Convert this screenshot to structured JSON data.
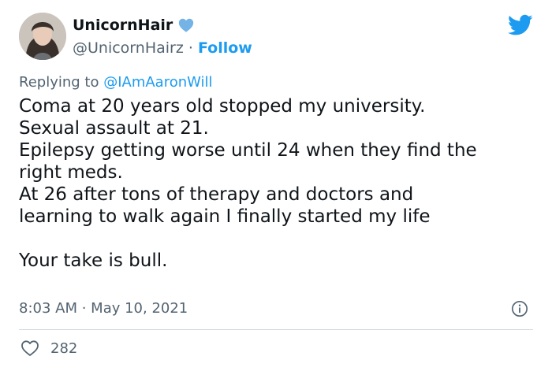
{
  "author": {
    "display_name": "UnicornHair",
    "handle": "@UnicornHairz",
    "separator": " · ",
    "follow_label": "Follow"
  },
  "reply": {
    "prefix": "Replying to ",
    "handle": "@IAmAaronWill"
  },
  "tweet": {
    "lines": [
      "Coma at 20 years old stopped my university.",
      "Sexual assault at 21.",
      "Epilepsy getting worse until 24 when they find the",
      "right meds.",
      "At 26 after tons of therapy and doctors and",
      "learning to walk again I finally started my life",
      "",
      "Your take is bull."
    ]
  },
  "meta": {
    "time": "8:03 AM",
    "separator": " · ",
    "date": "May 10, 2021"
  },
  "engagement": {
    "likes": "282"
  },
  "colors": {
    "accent": "#1d9bf0",
    "text": "#0f1419",
    "secondary": "#536471",
    "divider": "#cfd9de"
  },
  "icons": {
    "verified": "verified-badge-icon",
    "brand": "twitter-bird-icon",
    "info": "info-icon",
    "like": "heart-icon"
  }
}
